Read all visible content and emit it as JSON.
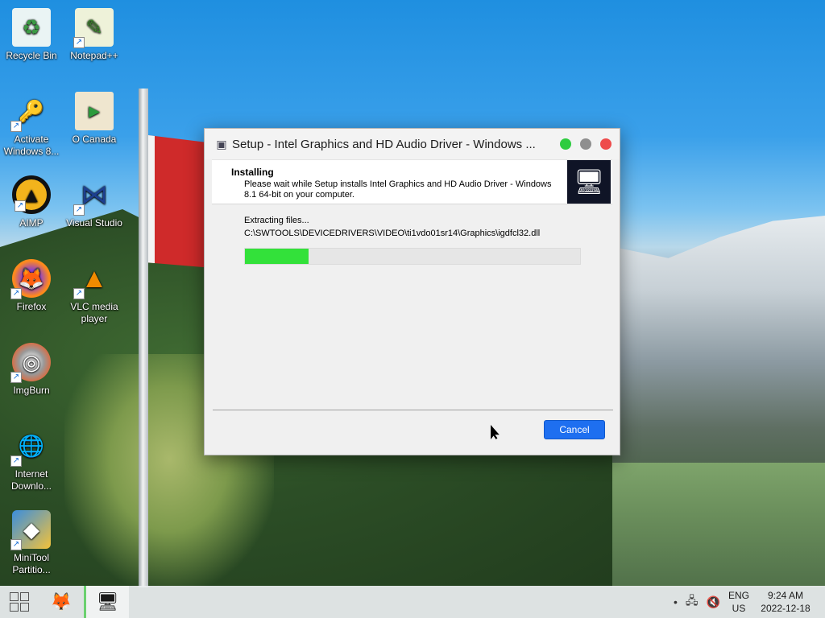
{
  "desktop_icons": [
    {
      "label": "Recycle Bin",
      "icon": "recycle-bin-icon",
      "glyph": "♻",
      "shortcut": false
    },
    {
      "label": "Notepad++",
      "icon": "notepad-plus-plus-icon",
      "glyph": "✎",
      "shortcut": true
    },
    {
      "label": "Activate Windows 8...",
      "icon": "key-shield-icon",
      "glyph": "🔑",
      "shortcut": true
    },
    {
      "label": "O Canada",
      "icon": "audio-file-icon",
      "glyph": "▶",
      "shortcut": false
    },
    {
      "label": "AIMP",
      "icon": "aimp-icon",
      "glyph": "▲",
      "shortcut": true
    },
    {
      "label": "Visual Studio",
      "icon": "visual-studio-icon",
      "glyph": "⋈",
      "shortcut": true
    },
    {
      "label": "Firefox",
      "icon": "firefox-icon",
      "glyph": "🦊",
      "shortcut": true
    },
    {
      "label": "VLC media player",
      "icon": "vlc-cone-icon",
      "glyph": "▲",
      "shortcut": true
    },
    {
      "label": "ImgBurn",
      "icon": "disc-burn-icon",
      "glyph": "◎",
      "shortcut": true
    },
    {
      "label": "Internet Downlo...",
      "icon": "internet-download-manager-icon",
      "glyph": "🌐",
      "shortcut": true
    },
    {
      "label": "MiniTool Partitio...",
      "icon": "minitool-partition-icon",
      "glyph": "◆",
      "shortcut": true
    }
  ],
  "dialog": {
    "title": "Setup - Intel Graphics and HD Audio Driver - Windows ...",
    "header_title": "Installing",
    "header_desc": "Please wait while Setup installs Intel Graphics and HD Audio Driver - Windows 8.1 64-bit on your computer.",
    "status_text": "Extracting files...",
    "file_path": "C:\\SWTOOLS\\DEVICEDRIVERS\\VIDEO\\ti1vdo01sr14\\Graphics\\igdfcl32.dll",
    "progress": 0.19,
    "cancel_label": "Cancel",
    "colors": {
      "close": "#ee4c4c",
      "minimize": "#8f8f8f",
      "maximize": "#2ecc40",
      "accent": "#1e6ff0",
      "progress": "#33e13a"
    }
  },
  "taskbar": {
    "apps": [
      {
        "name": "firefox-taskbar-icon",
        "glyph": "🦊"
      },
      {
        "name": "setup-taskbar-icon",
        "glyph": "🖥"
      }
    ],
    "tray": {
      "lang_top": "ENG",
      "lang_bottom": "US",
      "time": "9:24 AM",
      "date": "2022-12-18"
    }
  }
}
